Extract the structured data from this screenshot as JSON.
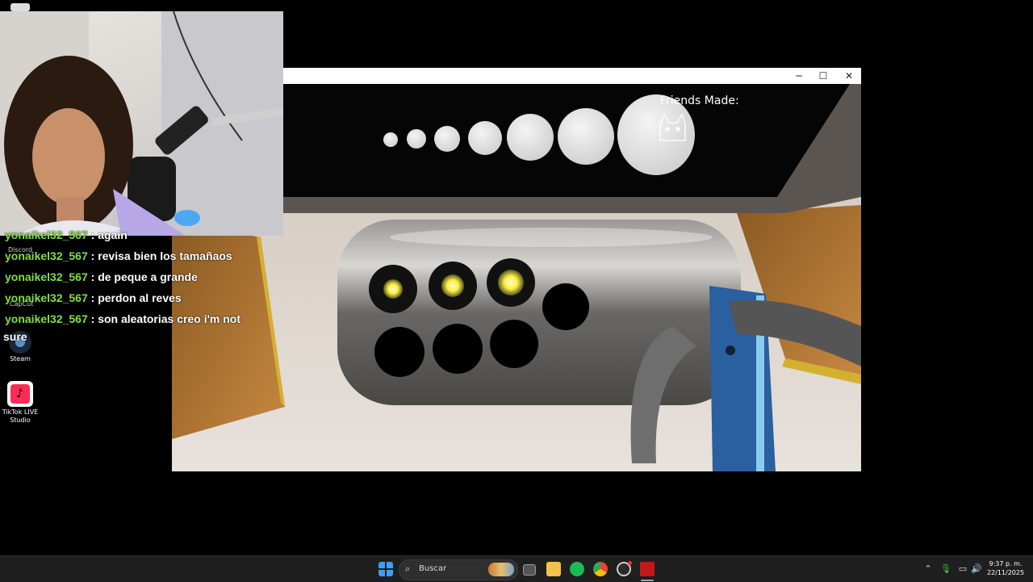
{
  "desktop": {
    "icons": [
      {
        "label": "Steam"
      },
      {
        "label": "TikTok LIVE Studio"
      }
    ],
    "partial_labels": [
      "Discord",
      "CapCut"
    ]
  },
  "webcam": {
    "icon": "webcam-feed"
  },
  "game": {
    "window_controls": {
      "minimize": "─",
      "maximize": "☐",
      "close": "✕"
    },
    "friends_label": "Friends Made:",
    "orb_count": 7,
    "lights": {
      "total": 7,
      "lit": 3
    }
  },
  "chat": {
    "messages": [
      {
        "user": "yonaikel32_567",
        "text": ": again"
      },
      {
        "user": "yonaikel32_567",
        "text": ": revisa bien los tamañaos"
      },
      {
        "user": "yonaikel32_567",
        "text": ": de peque a grande"
      },
      {
        "user": "yonaikel32_567",
        "text": ": perdon al reves"
      },
      {
        "user": "yonaikel32_567",
        "text": ": son aleatorias creo i'm not"
      }
    ],
    "wrap": "sure"
  },
  "taskbar": {
    "search_placeholder": "Buscar",
    "time": "9:37 p. m.",
    "date": "22/11/2025",
    "apps": [
      "windows-start-icon",
      "task-view-icon",
      "file-explorer-icon",
      "spotify-icon",
      "chrome-icon",
      "steam-icon",
      "game-app-icon"
    ]
  },
  "colors": {
    "chat_user": "#7fe040",
    "taskbar_bg": "#1f1f1f",
    "lit_light": "#ffee44"
  }
}
